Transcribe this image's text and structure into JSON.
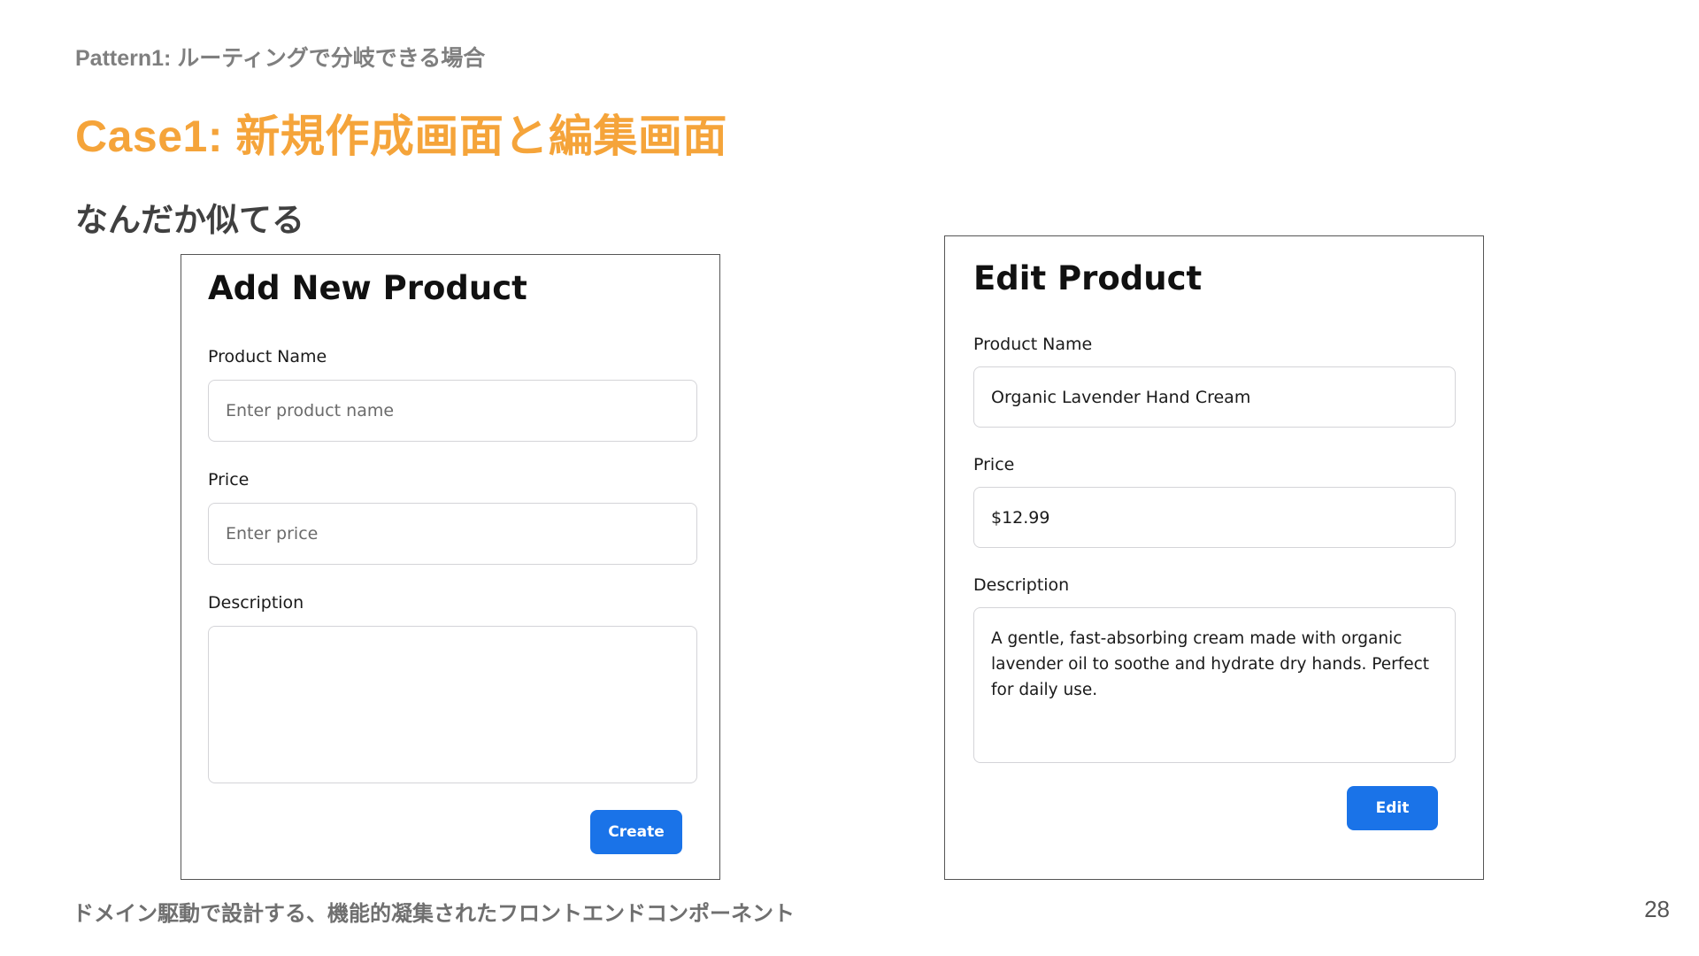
{
  "slide": {
    "kicker": "Pattern1: ルーティングで分岐できる場合",
    "title": "Case1: 新規作成画面と編集画面",
    "subtitle": "なんだか似てる",
    "footer": "ドメイン駆動で設計する、機能的凝集されたフロントエンドコンポーネント",
    "page_number": "28",
    "title_color": "#f5a43a"
  },
  "add_form": {
    "title": "Add New Product",
    "product_name_label": "Product Name",
    "product_name_placeholder": "Enter  product name",
    "price_label": "Price",
    "price_placeholder": "Enter   price",
    "description_label": "Description",
    "description_value": "",
    "submit_label": "Create"
  },
  "edit_form": {
    "title": "Edit Product",
    "product_name_label": "Product Name",
    "product_name_value": "Organic Lavender Hand Cream",
    "price_label": "Price",
    "price_value": "$12.99",
    "description_label": "Description",
    "description_value": "A gentle, fast-absorbing cream made with organic lavender oil to soothe and hydrate dry hands. Perfect for daily use.",
    "submit_label": "Edit"
  },
  "accent_color": "#1a73e8"
}
